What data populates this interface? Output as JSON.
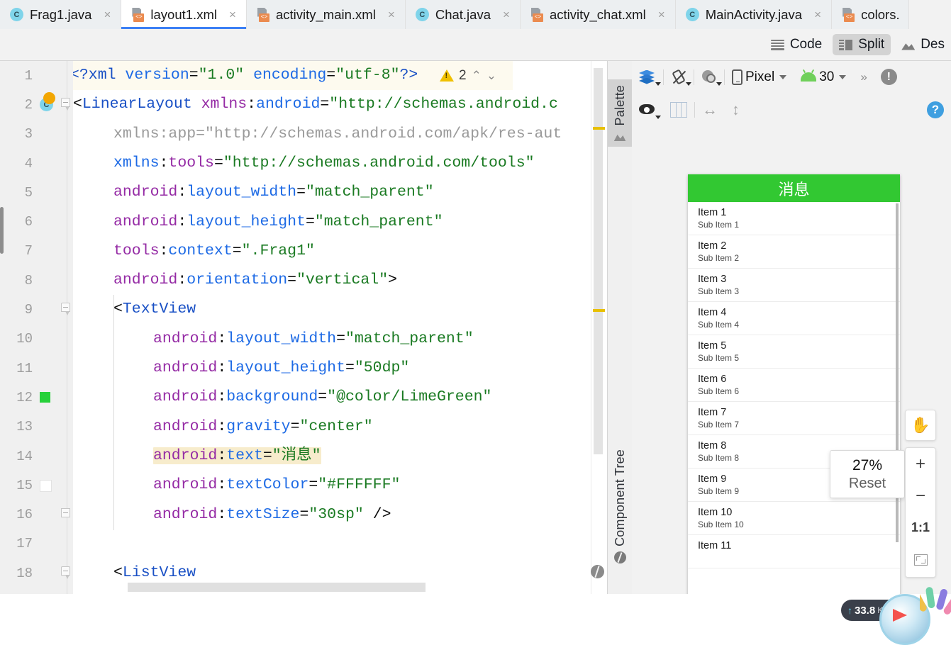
{
  "tabs": [
    {
      "label": "Frag1.java",
      "icon": "java-class-icon",
      "active": false
    },
    {
      "label": "layout1.xml",
      "icon": "xml-layout-icon",
      "active": true
    },
    {
      "label": "activity_main.xml",
      "icon": "xml-layout-icon",
      "active": false
    },
    {
      "label": "Chat.java",
      "icon": "java-class-icon",
      "active": false
    },
    {
      "label": "activity_chat.xml",
      "icon": "xml-layout-icon",
      "active": false
    },
    {
      "label": "MainActivity.java",
      "icon": "java-class-icon",
      "active": false
    },
    {
      "label": "colors.",
      "icon": "xml-layout-icon",
      "active": false
    }
  ],
  "tab_close_glyph": "×",
  "editor_modes": {
    "code": {
      "label": "Code",
      "icon": "code-lines-icon",
      "selected": false
    },
    "split": {
      "label": "Split",
      "icon": "split-view-icon",
      "selected": true
    },
    "design": {
      "label": "Des",
      "icon": "design-view-icon",
      "selected": false
    }
  },
  "inspection": {
    "warning_icon": "warning-triangle-icon",
    "count": "2",
    "prev_glyph": "⌃",
    "next_glyph": "⌄"
  },
  "code": {
    "language": "xml",
    "lines": [
      {
        "n": "1",
        "indent": 0
      },
      {
        "n": "2",
        "indent": 0
      },
      {
        "n": "3",
        "indent": 1
      },
      {
        "n": "4",
        "indent": 1
      },
      {
        "n": "5",
        "indent": 1
      },
      {
        "n": "6",
        "indent": 1
      },
      {
        "n": "7",
        "indent": 1
      },
      {
        "n": "8",
        "indent": 1
      },
      {
        "n": "9",
        "indent": 1
      },
      {
        "n": "10",
        "indent": 2
      },
      {
        "n": "11",
        "indent": 2
      },
      {
        "n": "12",
        "indent": 2
      },
      {
        "n": "13",
        "indent": 2
      },
      {
        "n": "14",
        "indent": 2
      },
      {
        "n": "15",
        "indent": 2
      },
      {
        "n": "16",
        "indent": 2
      },
      {
        "n": "17",
        "indent": 0
      },
      {
        "n": "18",
        "indent": 1
      }
    ],
    "text": {
      "l1": "<?xml version=\"1.0\" encoding=\"utf-8\"?>",
      "l2": "<LinearLayout xmlns:android=\"http://schemas.android.c",
      "l3": "xmlns:app=\"http://schemas.android.com/apk/res-aut",
      "l4": "xmlns:tools=\"http://schemas.android.com/tools\"",
      "l5": "android:layout_width=\"match_parent\"",
      "l6": "android:layout_height=\"match_parent\"",
      "l7": "tools:context=\".Frag1\"",
      "l8": "android:orientation=\"vertical\">",
      "l9": "<TextView",
      "l10": "android:layout_width=\"match_parent\"",
      "l11": "android:layout_height=\"50dp\"",
      "l12": "android:background=\"@color/LimeGreen\"",
      "l13": "android:gravity=\"center\"",
      "l14": "android:text=\"消息\"",
      "l15": "android:textColor=\"#FFFFFF\"",
      "l16": "android:textSize=\"30sp\" />",
      "l17": "",
      "l18": "<ListView"
    },
    "gutter_markers": {
      "line2_class_icon": "java-class-marker-icon",
      "line2_bulb": "intention-bulb-icon",
      "line12_color_swatch": "#27D13A",
      "line15_color_swatch": "#FFFFFF"
    },
    "highlighted_line": "14"
  },
  "tool_tabs": [
    {
      "label": "Palette",
      "icon": "palette-icon",
      "selected": true
    },
    {
      "label": "Component Tree",
      "icon": "component-tree-icon",
      "selected": false
    }
  ],
  "preview_toolbar": {
    "design_surface_icon": "layers-icon",
    "orientation_icon": "rotate-device-icon",
    "theme_icon": "theme-picker-icon",
    "device_icon": "phone-icon",
    "device": "Pixel",
    "api_icon": "android-robot-icon",
    "api_level": "30",
    "overflow_glyph": "»",
    "issue_badge_glyph": "!",
    "view_options_icon": "eye-icon",
    "blueprint_icon": "columns-icon",
    "resize_h_glyph": "↔",
    "resize_v_glyph": "↕",
    "help_glyph": "?",
    "design_tools_icon": "wrench-icon"
  },
  "device_preview": {
    "header_title": "消息",
    "header_color": "#32C832",
    "header_text_color": "#FFFFFF",
    "items": [
      {
        "title": "Item 1",
        "subtitle": "Sub Item 1"
      },
      {
        "title": "Item 2",
        "subtitle": "Sub Item 2"
      },
      {
        "title": "Item 3",
        "subtitle": "Sub Item 3"
      },
      {
        "title": "Item 4",
        "subtitle": "Sub Item 4"
      },
      {
        "title": "Item 5",
        "subtitle": "Sub Item 5"
      },
      {
        "title": "Item 6",
        "subtitle": "Sub Item 6"
      },
      {
        "title": "Item 7",
        "subtitle": "Sub Item 7"
      },
      {
        "title": "Item 8",
        "subtitle": "Sub Item 8"
      },
      {
        "title": "Item 9",
        "subtitle": "Sub Item 9"
      },
      {
        "title": "Item 10",
        "subtitle": "Sub Item 10"
      },
      {
        "title": "Item 11",
        "subtitle": ""
      }
    ]
  },
  "zoom_tooltip": {
    "percent": "27%",
    "reset_label": "Reset"
  },
  "zoom_controls": {
    "pan_icon": "hand-pan-icon",
    "zoom_in_glyph": "+",
    "zoom_out_glyph": "−",
    "actual_size_label": "1:1",
    "fit_icon": "fit-to-screen-icon"
  },
  "floating": {
    "network_up_glyph": "↑",
    "network_value": "33.8",
    "network_unit": "K/s",
    "orb_icon": "compass-orb-icon"
  }
}
